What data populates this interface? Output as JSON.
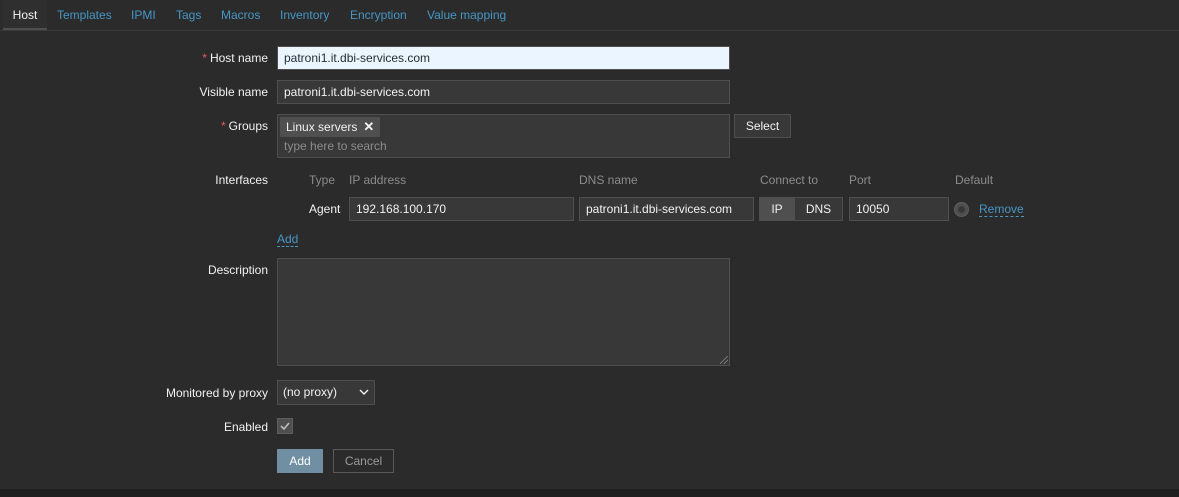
{
  "tabs": [
    {
      "label": "Host",
      "active": true
    },
    {
      "label": "Templates",
      "active": false
    },
    {
      "label": "IPMI",
      "active": false
    },
    {
      "label": "Tags",
      "active": false
    },
    {
      "label": "Macros",
      "active": false
    },
    {
      "label": "Inventory",
      "active": false
    },
    {
      "label": "Encryption",
      "active": false
    },
    {
      "label": "Value mapping",
      "active": false
    }
  ],
  "form": {
    "required_mark": "*",
    "host_name": {
      "label": "Host name",
      "value": "patroni1.it.dbi-services.com"
    },
    "visible_name": {
      "label": "Visible name",
      "value": "patroni1.it.dbi-services.com"
    },
    "groups": {
      "label": "Groups",
      "selected": [
        "Linux servers"
      ],
      "chip_remove": "✕",
      "search_placeholder": "type here to search",
      "select_button": "Select"
    },
    "interfaces": {
      "label": "Interfaces",
      "headers": {
        "type": "Type",
        "ip": "IP address",
        "dns": "DNS name",
        "connect": "Connect to",
        "port": "Port",
        "default": "Default"
      },
      "rows": [
        {
          "type": "Agent",
          "ip": "192.168.100.170",
          "dns": "patroni1.it.dbi-services.com",
          "connect_ip": "IP",
          "connect_dns": "DNS",
          "connect_selected": "IP",
          "port": "10050",
          "default": true,
          "remove": "Remove"
        }
      ],
      "add_link": "Add"
    },
    "description": {
      "label": "Description",
      "value": ""
    },
    "proxy": {
      "label": "Monitored by proxy",
      "value": "(no proxy)"
    },
    "enabled": {
      "label": "Enabled",
      "checked": true
    },
    "buttons": {
      "add": "Add",
      "cancel": "Cancel"
    }
  },
  "colors": {
    "background": "#2b2b2b",
    "link": "#4796c4",
    "required": "#e45959",
    "primary_button": "#718fa3",
    "focused_input": "#ebf5ff"
  }
}
